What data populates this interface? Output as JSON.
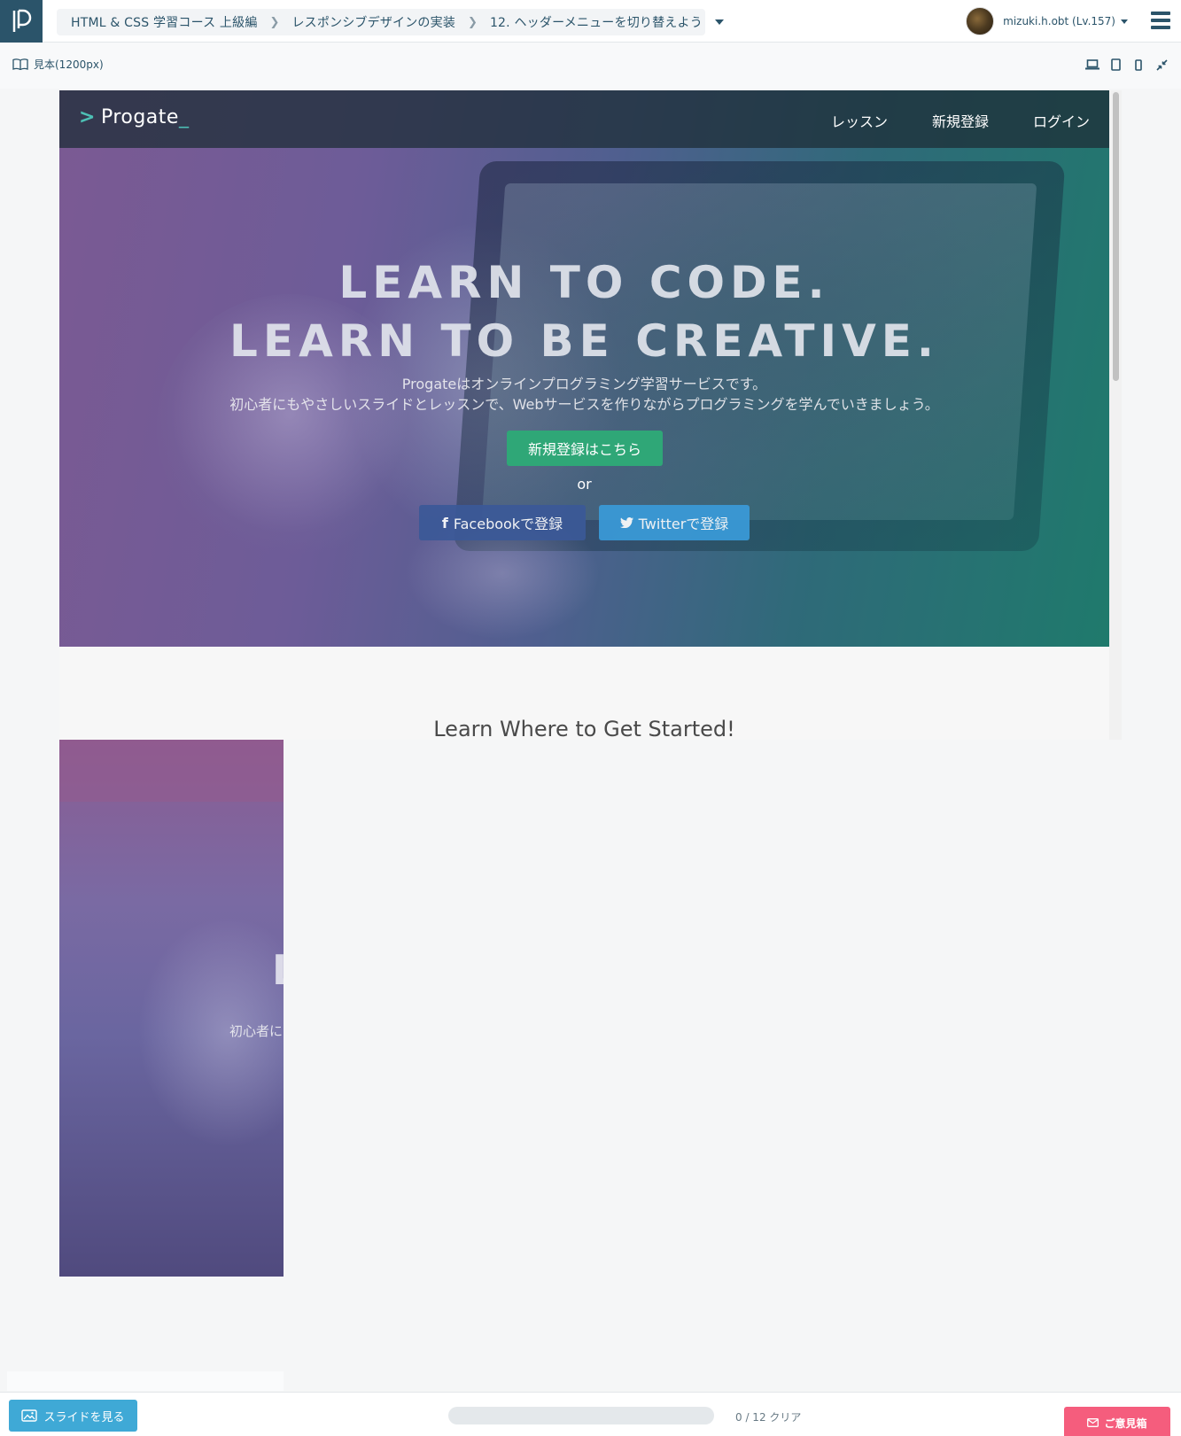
{
  "topbar": {
    "breadcrumb": [
      "HTML & CSS 学習コース 上級編",
      "レスポンシブデザインの実装",
      "12. ヘッダーメニューを切り替えよう"
    ],
    "username": "mizuki.h.obt (Lv.157)"
  },
  "preview": {
    "label": "見本(1200px)",
    "devices": [
      "laptop-icon",
      "tablet-icon",
      "phone-icon",
      "collapse-icon"
    ]
  },
  "site": {
    "logo": "Progate",
    "nav": [
      "レッスン",
      "新規登録",
      "ログイン"
    ],
    "hero_title_1": "LEARN TO CODE.",
    "hero_title_2": "LEARN TO BE CREATIVE.",
    "hero_sub_1": "Progateはオンラインプログラミング学習サービスです。",
    "hero_sub_2": "初心者にもやさしいスライドとレッスンで、Webサービスを作りながらプログラミングを学んでいきましょう。",
    "cta": "新規登録はこちら",
    "or": "or",
    "facebook": "Facebookで登録",
    "twitter": "Twitterで登録",
    "section_heading": "Learn Where to Get Started!"
  },
  "mobile": {
    "title_fragment": "L",
    "sub_fragment": "初心者に"
  },
  "bottombar": {
    "slide_button": "スライドを見る",
    "progress_text": "0 / 12 クリア",
    "progress_fraction": 0,
    "feedback_button": "ご意見箱"
  },
  "colors": {
    "brand_navy": "#2b546a",
    "accent_teal": "#4dc0b5",
    "cta_green": "#2fa777",
    "facebook": "#3b5998",
    "twitter": "#3a9bd9",
    "slide_blue": "#3fa9d6",
    "feedback_pink": "#f55d7d"
  }
}
